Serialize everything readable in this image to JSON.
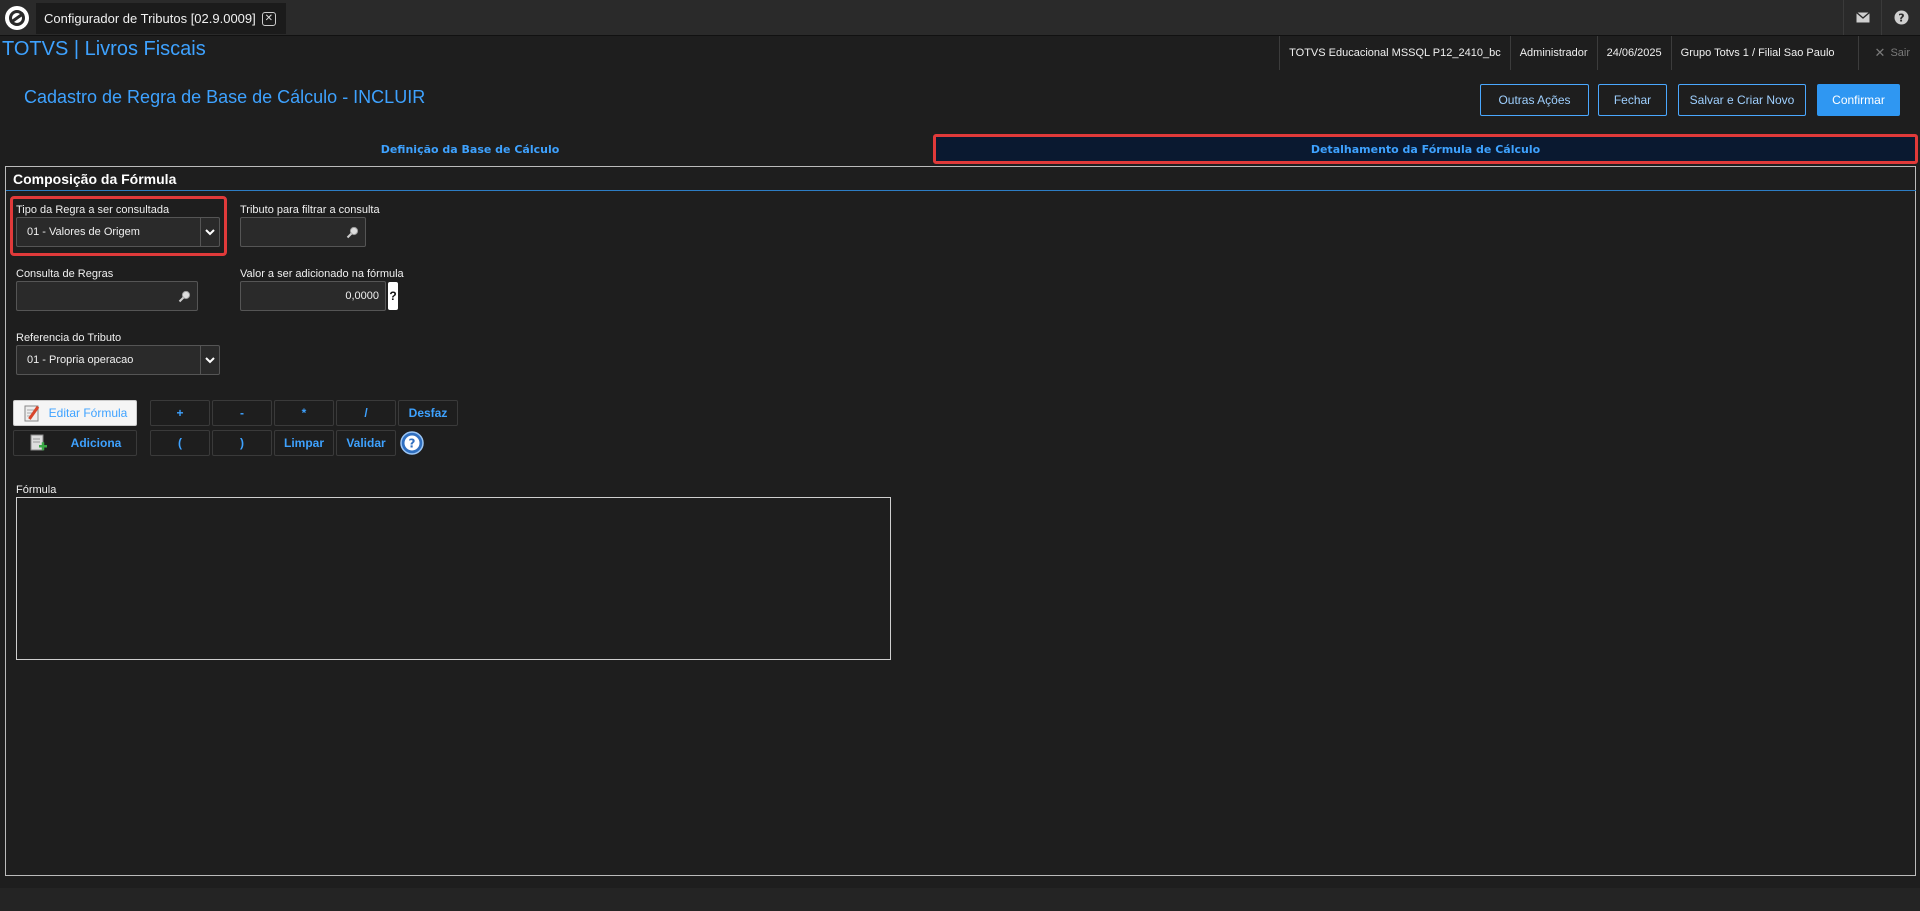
{
  "window": {
    "tab_title": "Configurador de Tributos [02.9.0009]"
  },
  "topbar": {
    "mail_icon": "mail-icon",
    "help_icon": "help-icon"
  },
  "brand": "TOTVS | Livros Fiscais",
  "info": {
    "environment": "TOTVS Educacional MSSQL P12_2410_bc",
    "user": "Administrador",
    "date": "24/06/2025",
    "branch": "Grupo Totvs 1 / Filial Sao Paulo",
    "exit_label": "Sair"
  },
  "page": {
    "title": "Cadastro de Regra de Base de Cálculo - INCLUIR"
  },
  "actions": {
    "outras": "Outras Ações",
    "fechar": "Fechar",
    "salvar_novo": "Salvar e Criar Novo",
    "confirmar": "Confirmar"
  },
  "tabs": [
    {
      "label": "Definição da Base de Cálculo",
      "active": false
    },
    {
      "label": "Detalhamento da Fórmula de Cálculo",
      "active": true
    }
  ],
  "section": {
    "title": "Composição da Fórmula"
  },
  "fields": {
    "tipo_regra": {
      "label": "Tipo da Regra a ser consultada",
      "value": "01 - Valores de Origem"
    },
    "tributo_filtro": {
      "label": "Tributo para filtrar a consulta",
      "value": ""
    },
    "consulta_regras": {
      "label": "Consulta de Regras",
      "value": ""
    },
    "valor_adicionado": {
      "label": "Valor a ser adicionado na fórmula",
      "value": "0,0000",
      "help": "?"
    },
    "referencia_tributo": {
      "label": "Referencia do Tributo",
      "value": "01 - Propria operacao"
    }
  },
  "formula_buttons": {
    "editar": "Editar Fórmula",
    "adiciona": "Adiciona",
    "plus": "+",
    "minus": "-",
    "times": "*",
    "divide": "/",
    "desfaz": "Desfaz",
    "open_paren": "(",
    "close_paren": ")",
    "limpar": "Limpar",
    "validar": "Validar"
  },
  "formula": {
    "label": "Fórmula",
    "value": ""
  },
  "colors": {
    "accent": "#3ea2ff",
    "highlight": "#e03a3a",
    "confirm": "#2f97f2"
  }
}
